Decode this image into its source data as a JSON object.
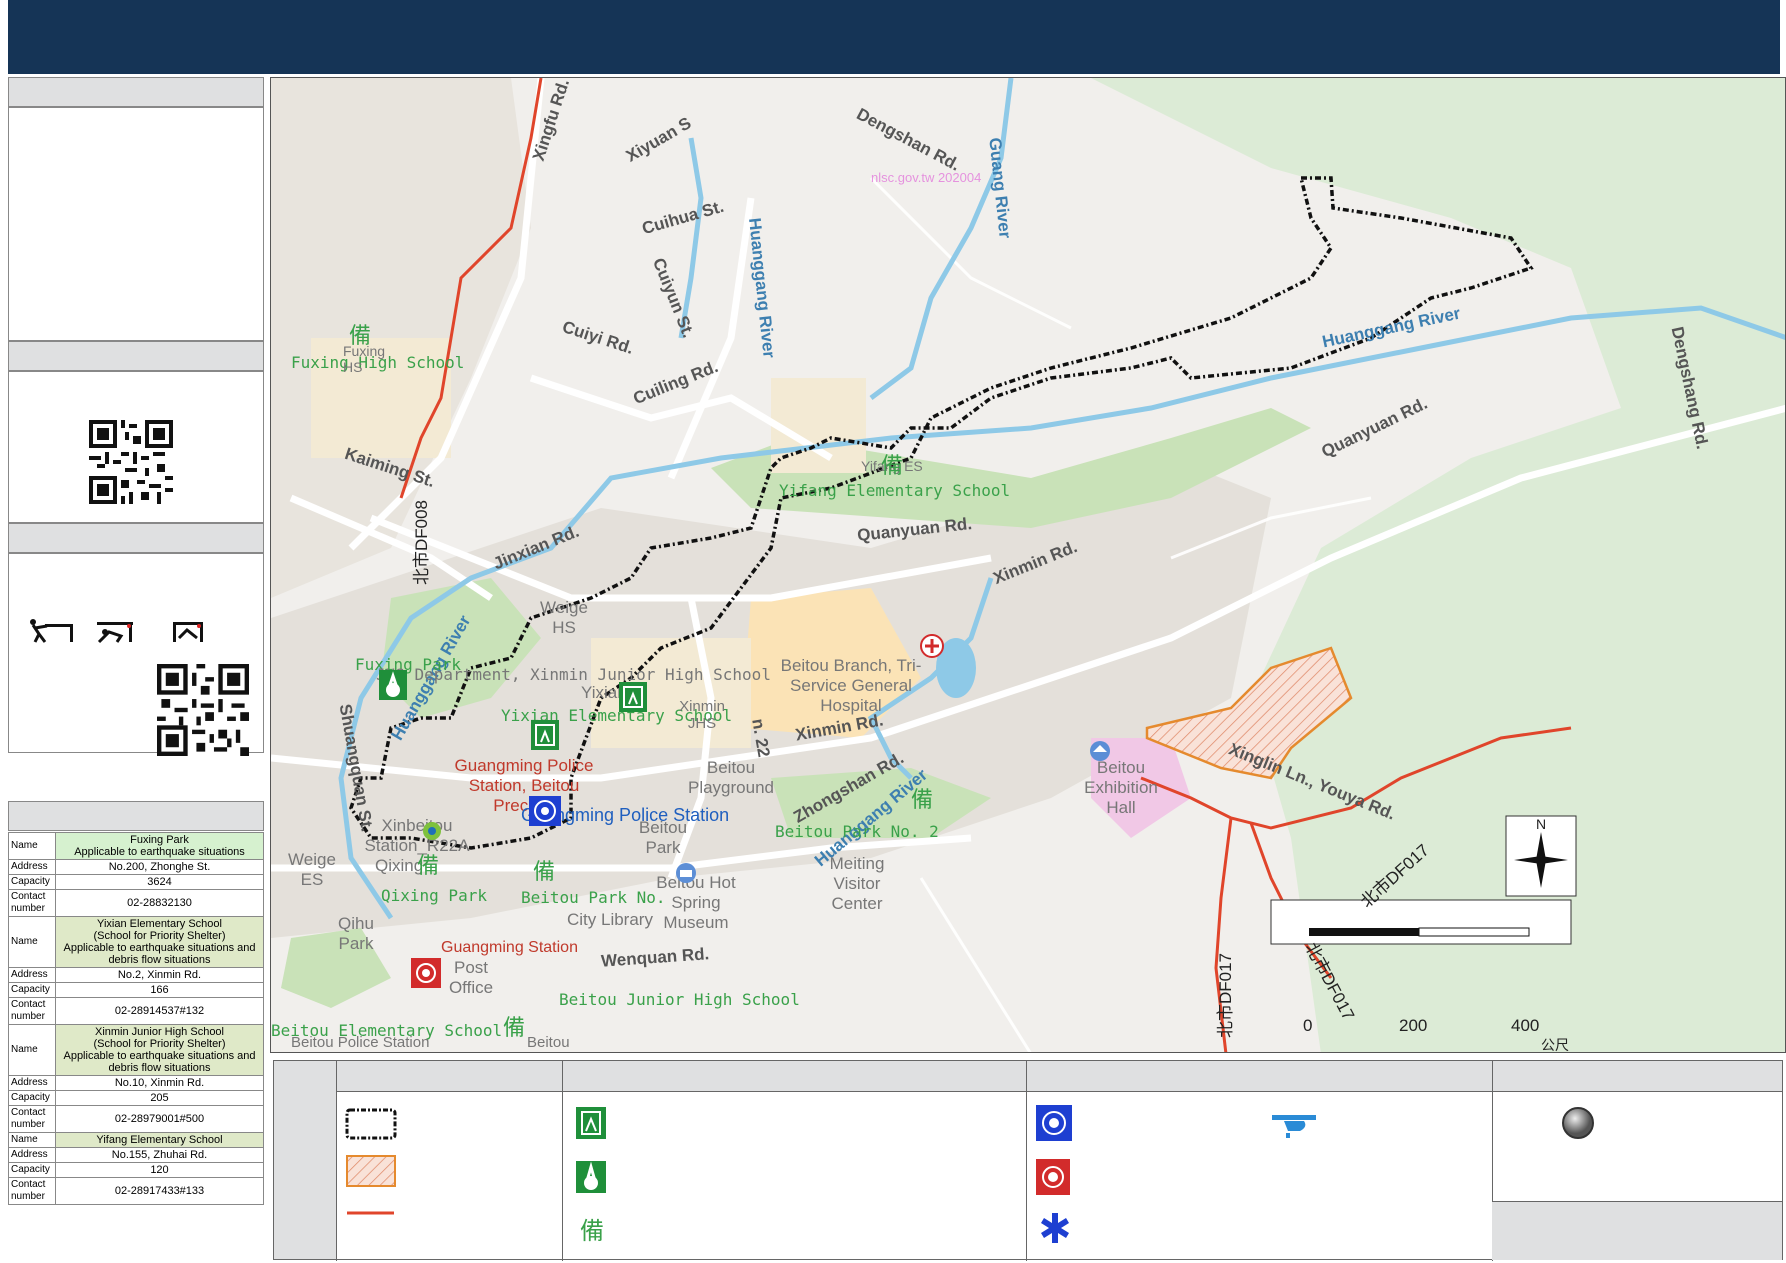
{
  "shelters": [
    {
      "name": "Fuxing Park",
      "note": "Applicable to earthquake situations",
      "address": "No.200, Zhonghe St.",
      "capacity": "3624",
      "contact": "02-28832130"
    },
    {
      "name": "Yixian Elementary School",
      "note": "(School for Priority Shelter)\nApplicable to earthquake situations and debris flow situations",
      "address": "No.2, Xinmin Rd.",
      "capacity": "166",
      "contact": "02-28914537#132"
    },
    {
      "name": "Xinmin Junior High School",
      "note": "(School for Priority Shelter)\nApplicable to earthquake situations and debris flow situations",
      "address": "No.10, Xinmin Rd.",
      "capacity": "205",
      "contact": "02-28979001#500"
    },
    {
      "name": "Yifang Elementary School",
      "note": "",
      "address": "No.155, Zhuhai Rd.",
      "capacity": "120",
      "contact": "02-28917433#133"
    }
  ],
  "table_keys": {
    "name": "Name",
    "address": "Address",
    "capacity": "Capacity",
    "contact": "Contact number"
  },
  "map": {
    "watermark": "nlsc.gov.tw 202004",
    "roads": {
      "xingfu": "Xingfu Rd.",
      "xiyuan": "Xiyuan S",
      "dengshan": "Dengshan Rd.",
      "cuihua": "Cuihua St.",
      "cuiyun": "Cuiyun St.",
      "cuiyi": "Cuiyi Rd.",
      "cuiling": "Cuiling Rd.",
      "kaiming": "Kaiming St.",
      "jinxian": "Jinxian Rd.",
      "quanyuan": "Quanyuan Rd.",
      "quanyuan2": "Quanyuan Rd.",
      "xinmin": "Xinmin Rd.",
      "xinmin2": "Xinmin Rd.",
      "zhongshan": "Zhongshan Rd.",
      "shuangquan": "Shuangquan St.",
      "wenquan": "Wenquan Rd.",
      "xinglin": "Xinglin Ln., Youya Rd.",
      "dengshan2": "Dengshang Rd.",
      "ln22": "n. 22"
    },
    "rivers": {
      "huanggang1": "Huanggang River",
      "huanggang2": "Huanggang River",
      "huanggang3": "Huanggang River",
      "huanggang4": "Huanggang River",
      "guang": "Guang River"
    },
    "places": {
      "fuxing_hs": "Fuxing High School",
      "fuxing_hs2": "Fuxing HS",
      "yifang_es": "Yifang Elementary School",
      "yifang_es2": "Yifang ES",
      "weige_hs": "Weige HS",
      "fuxing_park": "Fuxing Park",
      "jhs_dept": "JHS Department, Xinmin Junior High School",
      "yixian": "Yixian",
      "yixian_es": "Yixian Elementary School",
      "xinmin_jhs": "Xinmin JHS",
      "beitou_playground": "Beitou Playground",
      "hospital": "Beitou Branch, Tri-Service General Hospital",
      "police1": "Guangming Police Station, Beitou Precinct",
      "police2": "Guangming Police Station",
      "xinbeitou": "Xinbeitou Station_R22A",
      "qixing": "Qixing",
      "qixing_park": "Qixing Park",
      "beitou_park_no": "Beitou Park No.",
      "beitou_park": "Beitou Park",
      "beitou_hot": "Beitou Hot Spring Museum",
      "city_library": "City Library",
      "beitou_park_no2": "Beitou Park No. 2",
      "meiting": "Meiting Visitor Center",
      "weige_es": "Weige ES",
      "qihu_park": "Qihu Park",
      "guangming_station": "Guangming Station",
      "post_office": "Post Office",
      "beitou_jhs": "Beitou Junior High School",
      "beitou_es": "Beitou Elementary School",
      "beitou": "Beitou",
      "police_station_small": "Beitou Police Station",
      "exhibition": "Beitou Exhibition Hall"
    },
    "debris": {
      "df008": "北市DF008",
      "df017a": "北市DF017",
      "df017b": "北市DF017",
      "df017c": "北市DF017"
    },
    "scale": {
      "t0": "0",
      "t200": "200",
      "t400": "400",
      "unit": "公尺"
    },
    "north": "N"
  }
}
